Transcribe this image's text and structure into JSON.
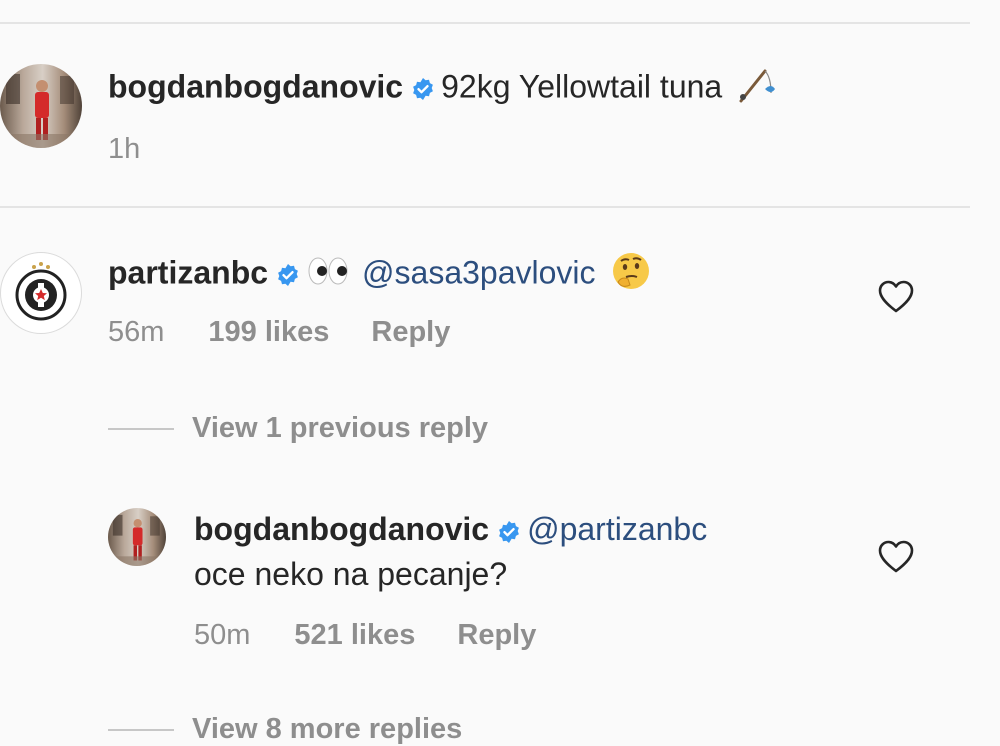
{
  "caption": {
    "username": "bogdanbogdanovic",
    "text": "92kg Yellowtail tuna",
    "emoji_icon": "fishing-pole-icon",
    "time": "1h"
  },
  "comment": {
    "username": "partizanbc",
    "mention": "@sasa3pavlovic",
    "emoji_icons": [
      "eyes-icon",
      "thinking-face-icon"
    ],
    "time": "56m",
    "likes": "199 likes",
    "reply_label": "Reply"
  },
  "view_previous": "View 1 previous reply",
  "reply": {
    "username": "bogdanbogdanovic",
    "mention": "@partizanbc",
    "text": "oce neko na pecanje?",
    "time": "50m",
    "likes": "521 likes",
    "reply_label": "Reply"
  },
  "view_more": "View 8 more replies",
  "colors": {
    "verified_badge": "#3897f0",
    "mention": "#2c4e7e",
    "meta_gray": "#8e8e8e"
  }
}
